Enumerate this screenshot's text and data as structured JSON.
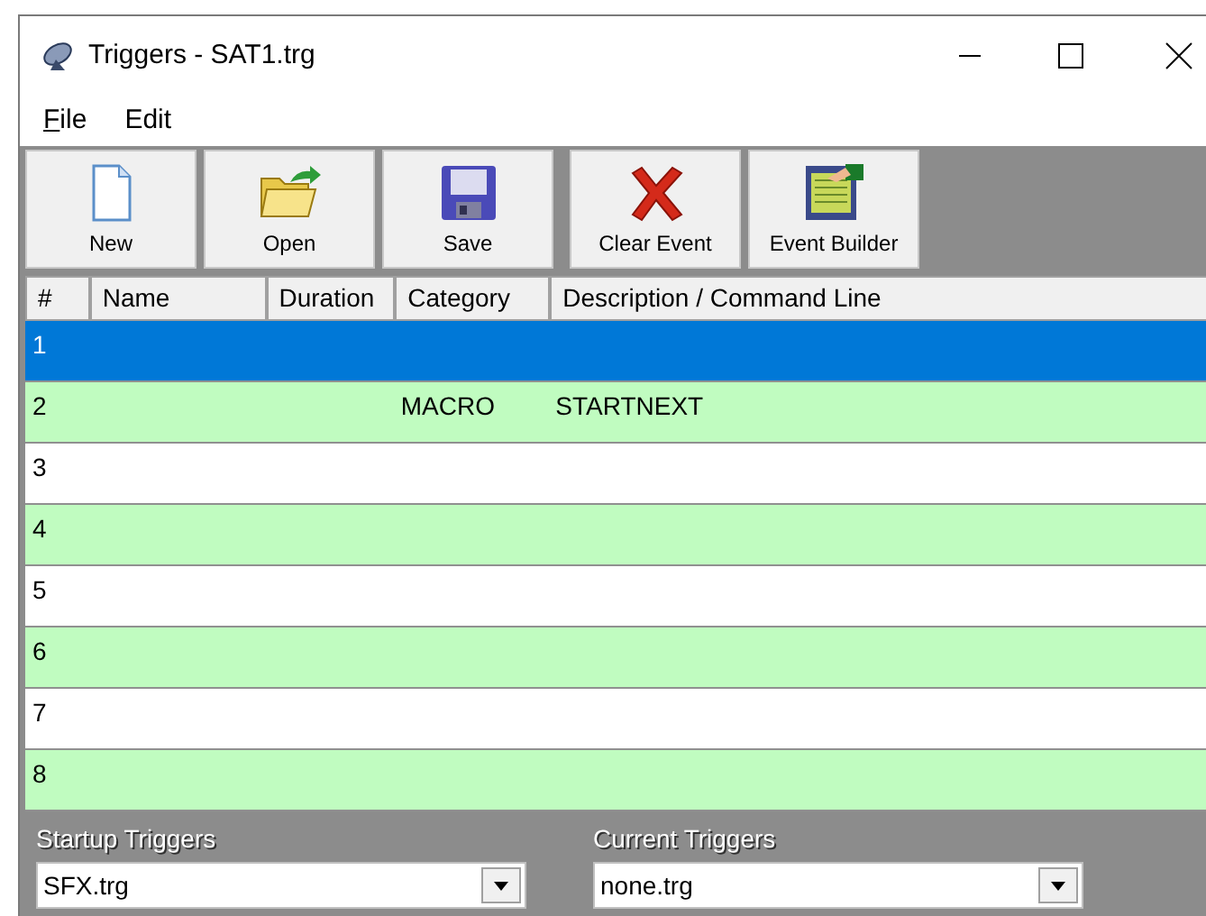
{
  "window": {
    "title": "Triggers - SAT1.trg"
  },
  "menu": [
    {
      "label": "File",
      "mnemonic": true
    },
    {
      "label": "Edit",
      "mnemonic": false
    }
  ],
  "toolbar": [
    {
      "label": "New",
      "kind": "new"
    },
    {
      "label": "Open",
      "kind": "open"
    },
    {
      "label": "Save",
      "kind": "save"
    },
    {
      "label": "Clear Event",
      "kind": "clear"
    },
    {
      "label": "Event Builder",
      "kind": "builder"
    }
  ],
  "table": {
    "columns": [
      "#",
      "Name",
      "Duration",
      "Category",
      "Description / Command Line"
    ],
    "rows": [
      {
        "cells": [
          "1",
          "",
          "",
          "",
          ""
        ],
        "selected": true,
        "shaded": false
      },
      {
        "cells": [
          "2",
          "",
          "",
          "MACRO",
          "STARTNEXT"
        ],
        "selected": false,
        "shaded": true
      },
      {
        "cells": [
          "3",
          "",
          "",
          "",
          ""
        ],
        "selected": false,
        "shaded": false
      },
      {
        "cells": [
          "4",
          "",
          "",
          "",
          ""
        ],
        "selected": false,
        "shaded": true
      },
      {
        "cells": [
          "5",
          "",
          "",
          "",
          ""
        ],
        "selected": false,
        "shaded": false
      },
      {
        "cells": [
          "6",
          "",
          "",
          "",
          ""
        ],
        "selected": false,
        "shaded": true
      },
      {
        "cells": [
          "7",
          "",
          "",
          "",
          ""
        ],
        "selected": false,
        "shaded": false
      },
      {
        "cells": [
          "8",
          "",
          "",
          "",
          ""
        ],
        "selected": false,
        "shaded": true
      }
    ]
  },
  "selectors": [
    {
      "label": "Startup Triggers",
      "value": "SFX.trg"
    },
    {
      "label": "Current Triggers",
      "value": "none.trg"
    }
  ]
}
